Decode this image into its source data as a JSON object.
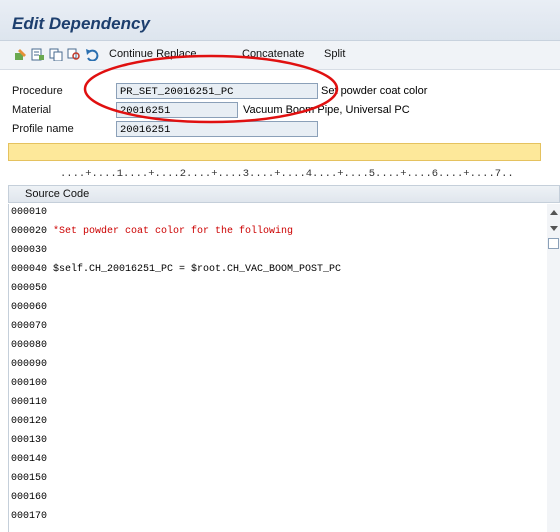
{
  "title": "Edit Dependency",
  "toolbar": {
    "continue_replace": "Continue Replace",
    "concatenate": "Concatenate",
    "split": "Split"
  },
  "form": {
    "procedure_label": "Procedure",
    "procedure_value": "PR_SET_20016251_PC",
    "procedure_desc": "Set powder coat color",
    "material_label": "Material",
    "material_value": "20016251",
    "material_desc": "Vacuum Boom Pipe, Universal PC",
    "profile_label": "Profile name",
    "profile_value": "20016251"
  },
  "command_line": "",
  "ruler": "....+....1....+....2....+....3....+....4....+....5....+....6....+....7..",
  "source_code_header": "Source Code",
  "lines": [
    {
      "num": "000010",
      "code": ""
    },
    {
      "num": "000020",
      "code": "*Set powder coat color for the following"
    },
    {
      "num": "000030",
      "code": ""
    },
    {
      "num": "000040",
      "code": "$self.CH_20016251_PC = $root.CH_VAC_BOOM_POST_PC"
    },
    {
      "num": "000050",
      "code": ""
    },
    {
      "num": "000060",
      "code": ""
    },
    {
      "num": "000070",
      "code": ""
    },
    {
      "num": "000080",
      "code": ""
    },
    {
      "num": "000090",
      "code": ""
    },
    {
      "num": "000100",
      "code": ""
    },
    {
      "num": "000110",
      "code": ""
    },
    {
      "num": "000120",
      "code": ""
    },
    {
      "num": "000130",
      "code": ""
    },
    {
      "num": "000140",
      "code": ""
    },
    {
      "num": "000150",
      "code": ""
    },
    {
      "num": "000160",
      "code": ""
    },
    {
      "num": "000170",
      "code": ""
    }
  ],
  "colors": {
    "title": "#1d3f6e",
    "comment": "#cc0000",
    "command_line_bg": "#fde89a",
    "annotation": "#e01010"
  }
}
